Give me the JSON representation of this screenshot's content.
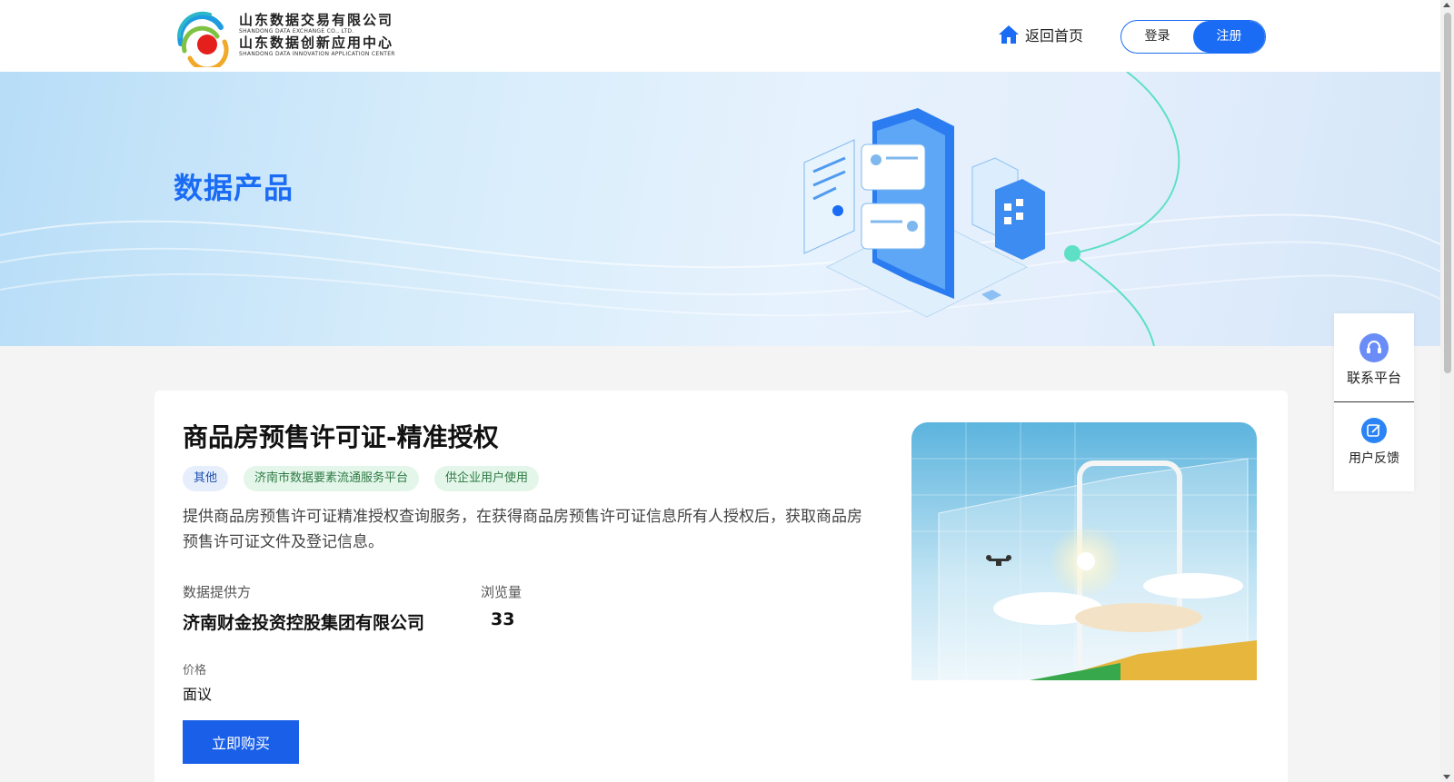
{
  "header": {
    "logo": {
      "company_cn": "山东数据交易有限公司",
      "company_en": "SHANDONG DATA EXCHANGE CO., LTD.",
      "center_cn": "山东数据创新应用中心",
      "center_en": "SHANDONG DATA INNOVATION APPLICATION CENTER"
    },
    "home_label": "返回首页",
    "login_label": "登录",
    "register_label": "注册"
  },
  "banner": {
    "title": "数据产品"
  },
  "product": {
    "title": "商品房预售许可证-精准授权",
    "tags": [
      {
        "label": "其他"
      },
      {
        "label": "济南市数据要素流通服务平台"
      },
      {
        "label": "供企业用户使用"
      }
    ],
    "description": "提供商品房预售许可证精准授权查询服务，在获得商品房预售许可证信息所有人授权后，获取商品房预售许可证文件及登记信息。",
    "provider_label": "数据提供方",
    "provider_value": "济南财金投资控股集团有限公司",
    "views_label": "浏览量",
    "views_value": "33",
    "price_label": "价格",
    "price_value": "面议",
    "buy_label": "立即购买"
  },
  "float_panel": {
    "contact_label": "联系平台",
    "feedback_label": "用户反馈"
  },
  "colors": {
    "primary": "#1a6cf5",
    "button": "#1a5fe8",
    "tag_blue_bg": "#e6eefc",
    "tag_green_bg": "#e3f6e9"
  },
  "icons": [
    "home-icon",
    "headset-icon",
    "edit-icon"
  ]
}
